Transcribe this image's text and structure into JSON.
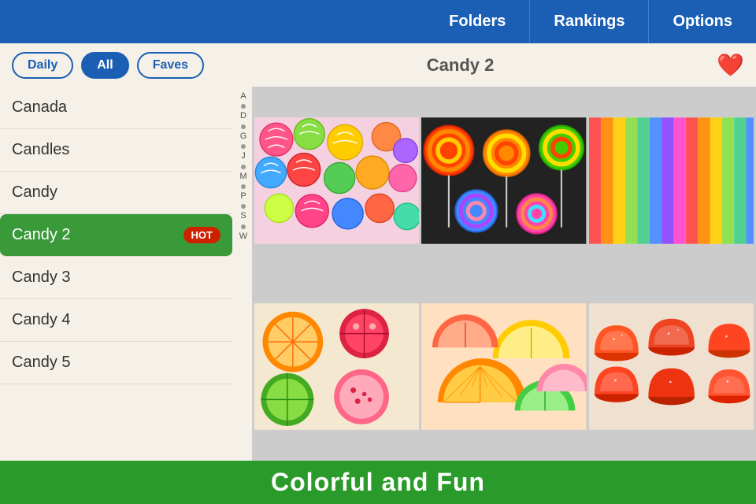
{
  "topNav": {
    "buttons": [
      {
        "label": "Folders",
        "name": "folders-nav"
      },
      {
        "label": "Rankings",
        "name": "rankings-nav"
      },
      {
        "label": "Options",
        "name": "options-nav"
      }
    ]
  },
  "filterRow": {
    "buttons": [
      {
        "label": "Daily",
        "name": "daily-filter",
        "active": false
      },
      {
        "label": "All",
        "name": "all-filter",
        "active": true
      },
      {
        "label": "Faves",
        "name": "faves-filter",
        "active": false
      }
    ],
    "puzzleTitle": "Candy 2",
    "heartIcon": "❤️"
  },
  "sidebar": {
    "items": [
      {
        "label": "Canada",
        "name": "canada-item",
        "active": false,
        "hot": false
      },
      {
        "label": "Candles",
        "name": "candles-item",
        "active": false,
        "hot": false
      },
      {
        "label": "Candy",
        "name": "candy-item",
        "active": false,
        "hot": false
      },
      {
        "label": "Candy 2",
        "name": "candy2-item",
        "active": true,
        "hot": true
      },
      {
        "label": "Candy 3",
        "name": "candy3-item",
        "active": false,
        "hot": false
      },
      {
        "label": "Candy 4",
        "name": "candy4-item",
        "active": false,
        "hot": false
      },
      {
        "label": "Candy 5",
        "name": "candy5-item",
        "active": false,
        "hot": false
      }
    ],
    "hotLabel": "HOT",
    "alphaLetters": [
      "A",
      "D",
      "G",
      "J",
      "M",
      "P",
      "S",
      "W"
    ]
  },
  "imageGrid": {
    "cells": [
      {
        "name": "grid-candy-balls",
        "index": 0
      },
      {
        "name": "grid-lollipops",
        "index": 1
      },
      {
        "name": "grid-rainbow-strips",
        "index": 2
      },
      {
        "name": "grid-fruit-candy",
        "index": 3
      },
      {
        "name": "grid-orange-slices",
        "index": 4
      },
      {
        "name": "grid-gumdrops",
        "index": 5
      }
    ]
  },
  "bottomBanner": {
    "text": "Colorful and Fun"
  }
}
